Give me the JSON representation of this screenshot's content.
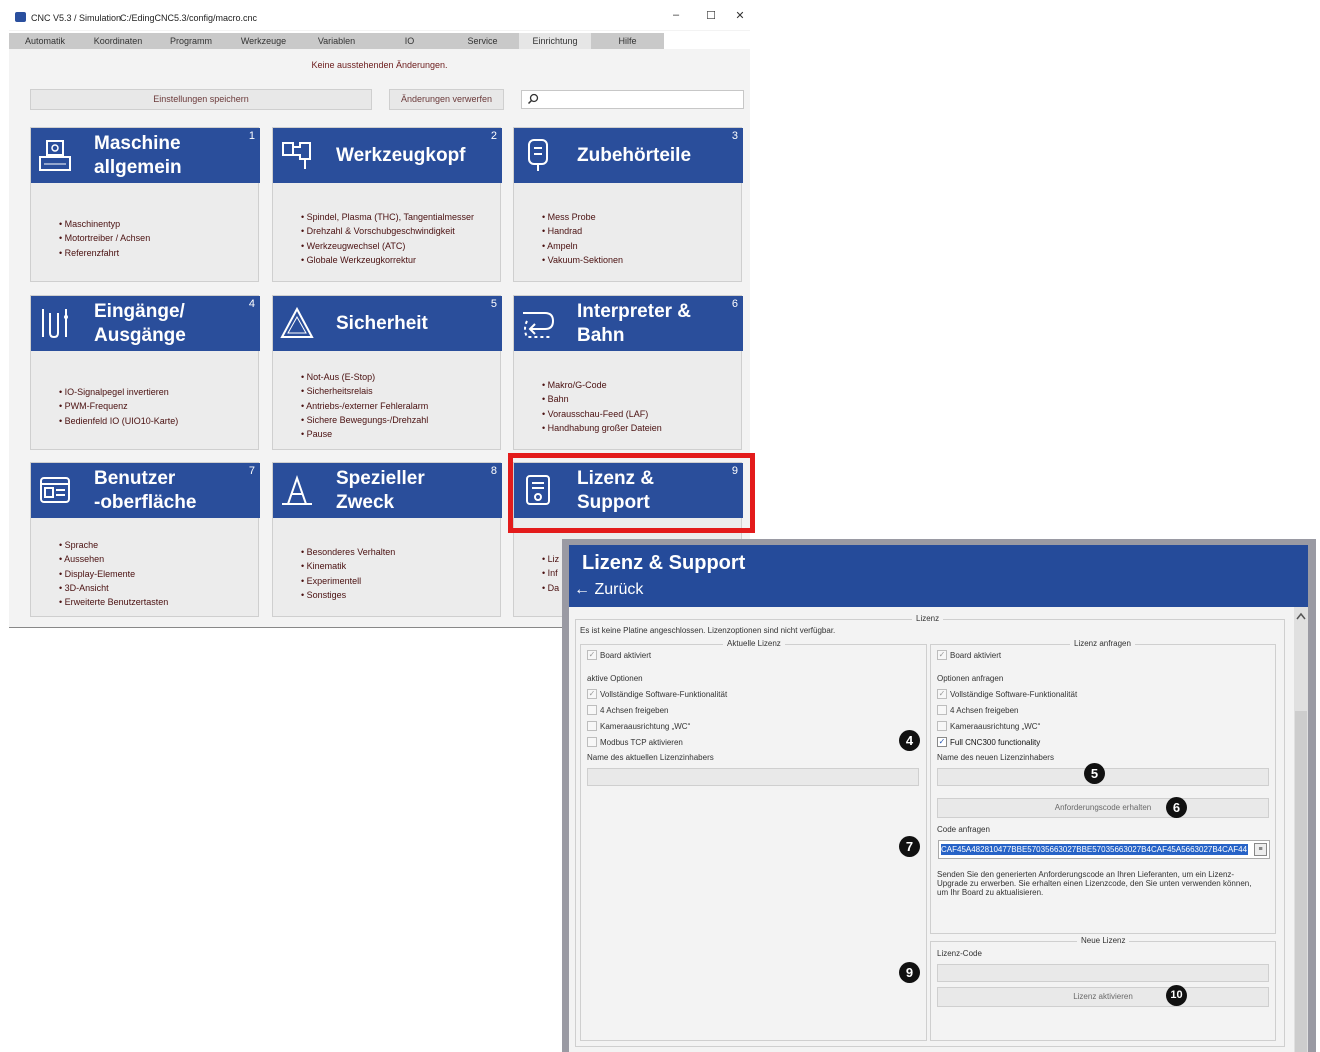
{
  "window": {
    "title": "CNC V5.3 / Simulation",
    "path": "C:/EdingCNC5.3/config/macro.cnc",
    "minimize": "–",
    "maximize": "☐",
    "close": "✕"
  },
  "tabs": [
    "Automatik",
    "Koordinaten",
    "Programm",
    "Werkzeuge",
    "Variablen",
    "IO",
    "Service",
    "Einrichtung",
    "Hilfe"
  ],
  "active_tab": "Einrichtung",
  "pending_text": "Keine ausstehenden Änderungen.",
  "buttons": {
    "save": "Einstellungen speichern",
    "discard": "Änderungen verwerfen"
  },
  "search": {
    "placeholder": ""
  },
  "tiles": [
    {
      "title1": "Maschine",
      "title2": "allgemein",
      "num": "1",
      "icon": "machine-icon",
      "items": [
        "Maschinentyp",
        "Motortreiber / Achsen",
        "Referenzfahrt"
      ]
    },
    {
      "title1": "Werkzeugkopf",
      "title2": "",
      "num": "2",
      "icon": "toolhead-icon",
      "items": [
        "Spindel, Plasma (THC), Tangentialmesser",
        "Drehzahl & Vorschubgeschwindigkeit",
        "Werkzeugwechsel (ATC)",
        "Globale Werkzeugkorrektur"
      ]
    },
    {
      "title1": "Zubehörteile",
      "title2": "",
      "num": "3",
      "icon": "accessory-icon",
      "items": [
        "Mess Probe",
        "Handrad",
        "Ampeln",
        "Vakuum-Sektionen"
      ]
    },
    {
      "title1": "Eingänge/",
      "title2": "Ausgänge",
      "num": "4",
      "icon": "io-icon",
      "items": [
        "IO-Signalpegel invertieren",
        "PWM-Frequenz",
        "Bedienfeld IO (UIO10-Karte)"
      ]
    },
    {
      "title1": "Sicherheit",
      "title2": "",
      "num": "5",
      "icon": "warning-icon",
      "items": [
        "Not-Aus (E-Stop)",
        "Sicherheitsrelais",
        "Antriebs-/externer Fehleralarm",
        "Sichere Bewegungs-/Drehzahl",
        "Pause"
      ]
    },
    {
      "title1": "Interpreter &",
      "title2": "Bahn",
      "num": "6",
      "icon": "path-icon",
      "items": [
        "Makro/G-Code",
        "Bahn",
        "Vorausschau-Feed (LAF)",
        "Handhabung großer Dateien"
      ]
    },
    {
      "title1": "Benutzer",
      "title2": "-oberfläche",
      "num": "7",
      "icon": "ui-icon",
      "items": [
        "Sprache",
        "Aussehen",
        "Display-Elemente",
        "3D-Ansicht",
        "Erweiterte Benutzertasten"
      ]
    },
    {
      "title1": "Spezieller",
      "title2": "Zweck",
      "num": "8",
      "icon": "special-icon",
      "items": [
        "Besonderes Verhalten",
        "Kinematik",
        "Experimentell",
        "Sonstiges"
      ]
    },
    {
      "title1": "Lizenz &",
      "title2": "Support",
      "num": "9",
      "icon": "license-icon",
      "items": [
        "Liz",
        "Inf",
        "Da"
      ]
    }
  ],
  "panel": {
    "title": "Lizenz & Support",
    "back": "← Zurück",
    "lizenz_group": "Lizenz",
    "no_board": "Es ist keine Platine angeschlossen. Lizenzoptionen sind nicht verfügbar.",
    "current": {
      "title": "Aktuelle Lizenz",
      "board": "Board aktiviert",
      "options_label": "aktive Optionen",
      "options": [
        "Vollständige Software-Funktionalität",
        "4 Achsen freigeben",
        "Kameraausrichtung „WC“",
        "Modbus TCP aktivieren"
      ],
      "owner_label": "Name des aktuellen Lizenzinhabers"
    },
    "request": {
      "title": "Lizenz anfragen",
      "board": "Board aktiviert",
      "options_label": "Optionen anfragen",
      "options": [
        "Vollständige Software-Funktionalität",
        "4 Achsen freigeben",
        "Kameraausrichtung „WC“",
        "Full CNC300 functionality"
      ],
      "owner_label": "Name des neuen Lizenzinhabers",
      "get_code_button": "Anforderungscode erhalten",
      "code_label": "Code anfragen",
      "code_value": "CAF45A482810477BBE57035663027BBE57035663027B4CAF45A5663027B4CAF44",
      "info": "Senden Sie den generierten Anforderungscode an Ihren Lieferanten, um ein Lizenz-Upgrade zu erwerben. Sie erhalten einen Lizenzcode, den Sie unten verwenden können, um Ihr Board zu aktualisieren."
    },
    "new": {
      "title": "Neue Lizenz",
      "code_label": "Lizenz-Code",
      "activate_button": "Lizenz aktivieren"
    }
  },
  "badges": [
    "4",
    "5",
    "6",
    "7",
    "9",
    "10"
  ]
}
